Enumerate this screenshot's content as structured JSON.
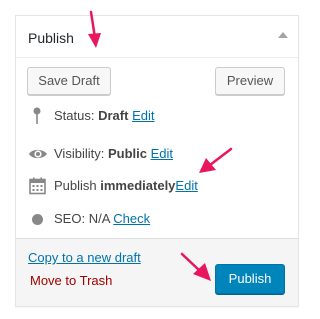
{
  "publish_box": {
    "title": "Publish",
    "save_draft_label": "Save Draft",
    "preview_label": "Preview",
    "status": {
      "label": "Status:",
      "value": "Draft",
      "edit": "Edit",
      "icon": "pin-icon"
    },
    "visibility": {
      "label": "Visibility:",
      "value": "Public",
      "edit": "Edit",
      "icon": "eye-icon"
    },
    "schedule": {
      "label": "Publish",
      "value": "immediately",
      "edit": "Edit",
      "icon": "calendar-icon"
    },
    "seo": {
      "label": "SEO:",
      "value": "N/A",
      "action": "Check",
      "icon": "status-dot-icon"
    },
    "copy_draft_label": "Copy to a new draft",
    "trash_label": "Move to Trash",
    "publish_label": "Publish"
  },
  "colors": {
    "link": "#0073aa",
    "trash": "#a00000",
    "primary_button": "#0085ba",
    "annotation_arrow": "#e8175d"
  }
}
